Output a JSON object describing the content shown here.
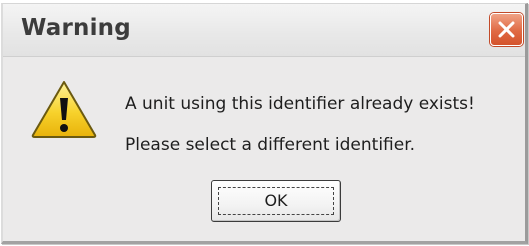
{
  "dialog": {
    "title": "Warning",
    "close_icon": "close-icon",
    "warning_icon": "warning-triangle-icon",
    "message_line1": "A unit using this identifier already exists!",
    "message_line2": "Please select a different identifier.",
    "ok_label": "OK"
  },
  "colors": {
    "dialog_background": "#ebeaea",
    "close_button": "#e06a44",
    "warning_icon_fill": "#f7d22c"
  }
}
